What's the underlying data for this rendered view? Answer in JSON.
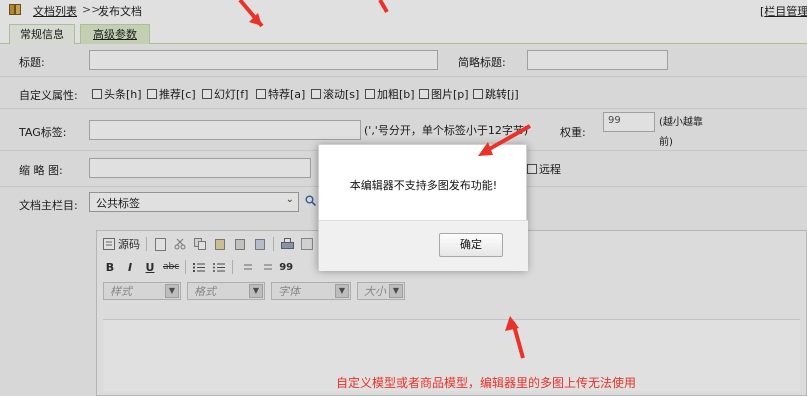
{
  "breadcrumb": {
    "list_link": "文档列表",
    "separator": ">>",
    "current": "发布文档"
  },
  "column_manager": {
    "bracket": "[",
    "label": "栏目管理"
  },
  "tabs": {
    "basic": "常规信息",
    "advanced": "高级参数"
  },
  "form": {
    "title_label": "标题:",
    "short_title_label": "简略标题:",
    "attr_label": "自定义属性:",
    "attrs": [
      "头条[h]",
      "推荐[c]",
      "幻灯[f]",
      "特荐[a]",
      "滚动[s]",
      "加粗[b]",
      "图片[p]",
      "跳转[j]"
    ],
    "tag_label": "TAG标签:",
    "tag_hint": "(','号分开，单个标签小于12字节)",
    "weight_label": "权重:",
    "weight_value": "99",
    "weight_hint": "(越小越靠前)",
    "thumb_label": "缩 略 图:",
    "remote_label": "远程",
    "main_col_label": "文档主栏目:",
    "main_col_value": "公共标签"
  },
  "editor": {
    "source_label": "源码",
    "style_placeholder": "样式",
    "format_placeholder": "格式",
    "font_placeholder": "字体",
    "size_placeholder": "大小",
    "bold": "B",
    "italic": "I",
    "underline": "U",
    "strike": "abc",
    "quote": "99"
  },
  "dialog": {
    "message": "本编辑器不支持多图发布功能!",
    "ok_label": "确定"
  },
  "annotation": {
    "text": "自定义模型或者商品模型，编辑器里的多图上传无法使用",
    "color": "#e8322a"
  }
}
